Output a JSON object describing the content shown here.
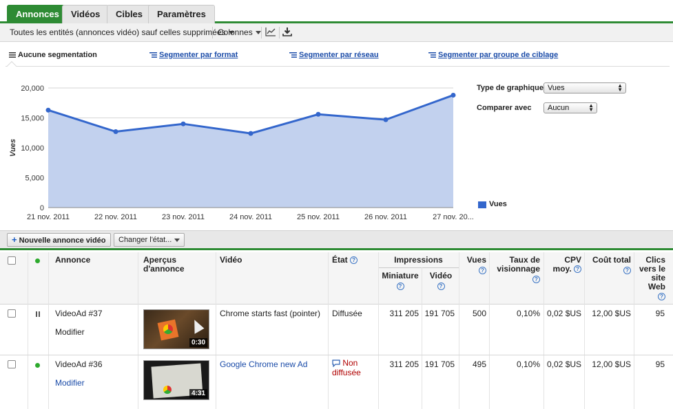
{
  "tabs": [
    {
      "label": "Annonces",
      "active": true
    },
    {
      "label": "Vidéos",
      "active": false
    },
    {
      "label": "Cibles",
      "active": false
    },
    {
      "label": "Paramètres",
      "active": false
    }
  ],
  "toolbar": {
    "filter_label": "Toutes les entités (annonces vidéo) sauf celles supprimées",
    "columns_label": "Colonnes",
    "chart_icon": "line-chart-icon",
    "download_icon": "download-icon"
  },
  "segments": {
    "none": "Aucune segmentation",
    "by_format": "Segmenter par format",
    "by_network": "Segmenter par réseau",
    "by_targeting": "Segmenter par groupe de ciblage"
  },
  "chart_options": {
    "type_label": "Type de graphique",
    "type_value": "Vues",
    "compare_label": "Comparer avec",
    "compare_value": "Aucun"
  },
  "chart_data": {
    "type": "area",
    "x": [
      "21 nov. 2011",
      "22 nov. 2011",
      "23 nov. 2011",
      "24 nov. 2011",
      "25 nov. 2011",
      "26 nov. 2011",
      "27 nov. 20..."
    ],
    "series": [
      {
        "name": "Vues",
        "values": [
          16300,
          12700,
          14000,
          12400,
          15600,
          14700,
          18800
        ]
      }
    ],
    "ylabel": "Vues",
    "yticks": [
      "0",
      "5,000",
      "10,000",
      "15,000",
      "20,000"
    ],
    "ylim": [
      0,
      20000
    ],
    "legend": "right",
    "grid": true,
    "colors": {
      "line": "#3366cc",
      "fill": "#c2d1ee"
    }
  },
  "actions": {
    "new_ad": "Nouvelle annonce vidéo",
    "change_state": "Changer l'état..."
  },
  "table": {
    "headers": {
      "annonce": "Annonce",
      "apercus_1": "Aperçus",
      "apercus_2": "d'annonce",
      "video": "Vidéo",
      "etat": "État",
      "impressions": "Impressions",
      "miniature": "Miniature",
      "video_imp": "Vidéo",
      "vues": "Vues",
      "taux_1": "Taux de",
      "taux_2": "visionnage",
      "cpv_1": "CPV",
      "cpv_2": "moy.",
      "cout": "Coût total",
      "clics_1": "Clics",
      "clics_2": "vers le",
      "clics_3": "site",
      "clics_4": "Web"
    },
    "rows": [
      {
        "status": "paused",
        "name": "VideoAd #37",
        "edit": "Modifier",
        "duration": "0:30",
        "video": "Chrome starts fast (pointer)",
        "state": "Diffusée",
        "miniature": "311 205",
        "video_imp": "191 705",
        "vues": "500",
        "taux": "0,10%",
        "cpv": "0,02 $US",
        "cout": "12,00 $US",
        "clics": "95"
      },
      {
        "status": "active",
        "name": "VideoAd #36",
        "edit": "Modifier",
        "duration": "4:31",
        "video": "Google Chrome new Ad",
        "state_1": "Non",
        "state_2": "diffusée",
        "miniature": "311 205",
        "video_imp": "191 705",
        "vues": "495",
        "taux": "0,10%",
        "cpv": "0,02 $US",
        "cout": "12,00 $US",
        "clics": "95"
      }
    ]
  }
}
